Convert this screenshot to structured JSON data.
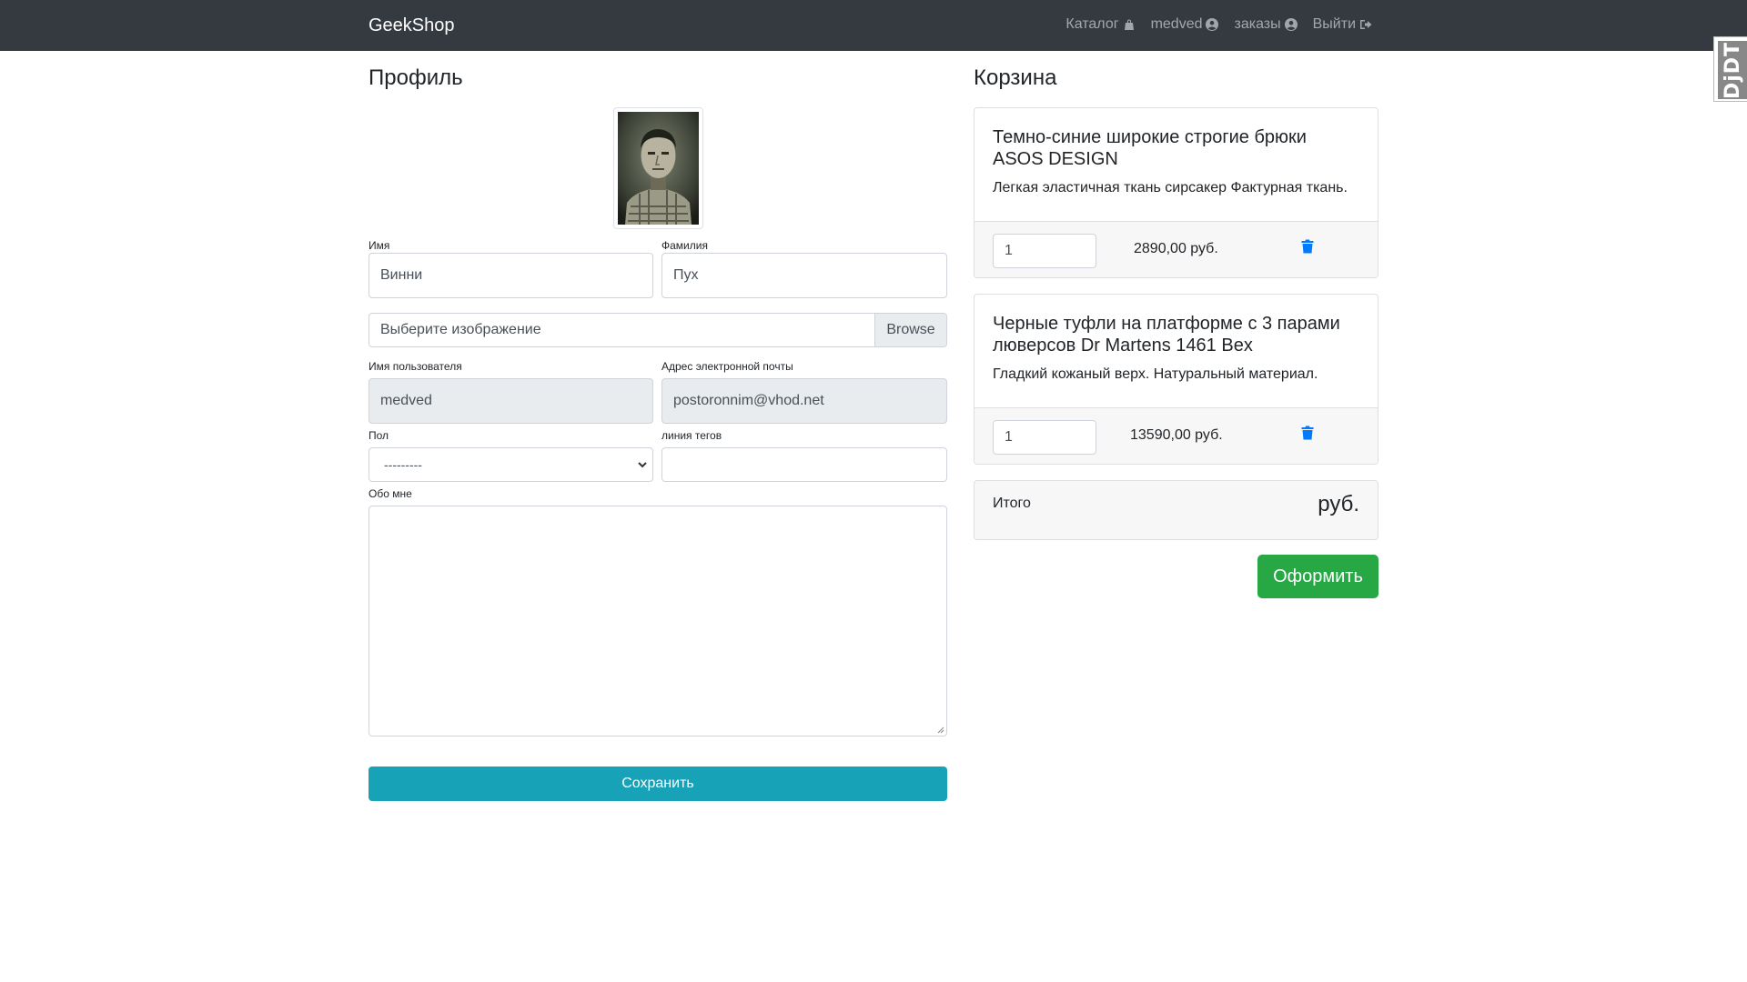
{
  "navbar": {
    "brand": "GeekShop",
    "links": [
      {
        "label": "Каталог",
        "icon": "shopping-bag-icon"
      },
      {
        "label": "medved",
        "icon": "user-circle-icon"
      },
      {
        "label": "заказы",
        "icon": "user-circle-icon"
      },
      {
        "label": "Выйти",
        "icon": "sign-out-icon"
      }
    ]
  },
  "debug_toolbar": {
    "label": "DjDT"
  },
  "profile": {
    "title": "Профиль",
    "first_name": {
      "label": "Имя",
      "value": "Винни"
    },
    "last_name": {
      "label": "Фамилия",
      "value": "Пух"
    },
    "image": {
      "placeholder": "Выберите изображение",
      "browse": "Browse"
    },
    "username": {
      "label": "Имя пользователя",
      "value": "medved"
    },
    "email": {
      "label": "Адрес электронной почты",
      "value": "postoronnim@vhod.net"
    },
    "gender": {
      "label": "Пол",
      "value": "---------"
    },
    "tagline": {
      "label": "линия тегов",
      "value": ""
    },
    "about": {
      "label": "Обо мне",
      "value": ""
    },
    "save_label": "Сохранить"
  },
  "cart": {
    "title": "Корзина",
    "items": [
      {
        "name": "Темно-синие широкие строгие брюки ASOS DESIGN",
        "description": "Легкая эластичная ткань сирсакер Фактурная ткань.",
        "quantity": "1",
        "price": "2890,00 руб."
      },
      {
        "name": "Черные туфли на платформе с 3 парами люверсов Dr Martens 1461 Bex",
        "description": "Гладкий кожаный верх. Натуральный материал.",
        "quantity": "1",
        "price": "13590,00 руб."
      }
    ],
    "total_label": "Итого",
    "total_value": "руб.",
    "checkout_label": "Оформить"
  },
  "colors": {
    "navbar": "#343a40",
    "save_button": "#17a2b8",
    "checkout_button": "#28a745",
    "trash_icon": "#007bff"
  }
}
